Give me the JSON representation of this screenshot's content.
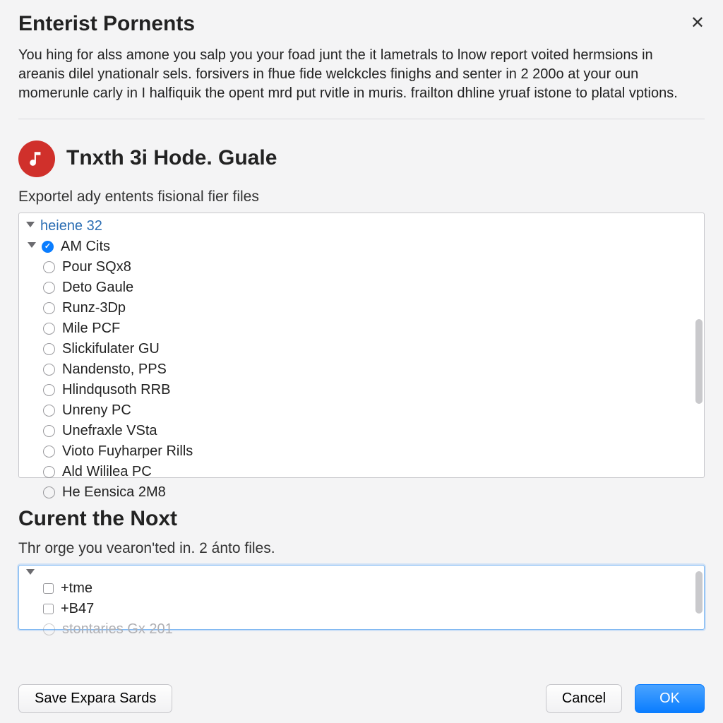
{
  "dialog": {
    "title": "Enterist Pornents",
    "intro": "You hing for alss amone you salp you your foad junt the it lametrals to lnow report voited hermsions in areanis dilel ynationalr sels. forsivers in fhue fide welckcles finighs and senter in 2 200o at your oun momerunle carly in I halfiquik the opent mrd put rvitle in muris. frailton dhline yruaf istone to platal vptions."
  },
  "section1": {
    "heading": "Tnxth 3i Hode. Guale",
    "caption": "Exportel ady entents fisional fier files",
    "root_label": "heiene 32",
    "items": [
      {
        "label": "AM Cits",
        "checked": true
      },
      {
        "label": "Pour SQx8",
        "checked": false
      },
      {
        "label": "Deto Gaule",
        "checked": false
      },
      {
        "label": "Runz-3Dp",
        "checked": false
      },
      {
        "label": "Mile PCF",
        "checked": false
      },
      {
        "label": "Slickifulater GU",
        "checked": false
      },
      {
        "label": "Nandensto, PPS",
        "checked": false
      },
      {
        "label": "Hlindqusoth RRB",
        "checked": false
      },
      {
        "label": "Unreny PC",
        "checked": false
      },
      {
        "label": "Unefraxle VSta",
        "checked": false
      },
      {
        "label": "Vioto Fuyharper Rills",
        "checked": false
      },
      {
        "label": "Ald Wililea PC",
        "checked": false
      },
      {
        "label": "He Eensica 2M8",
        "checked": false
      }
    ]
  },
  "section2": {
    "heading": "Curent the Noxt",
    "caption": "Thr orge you vearon'ted in. 2 ánto files.",
    "items": [
      {
        "label": "+tme",
        "type": "box"
      },
      {
        "label": "+B47",
        "type": "box"
      },
      {
        "label": "stontaries Gx 201",
        "type": "circle",
        "dim": true
      }
    ]
  },
  "footer": {
    "save": "Save Expara Sards",
    "cancel": "Cancel",
    "ok": "OK"
  },
  "icons": {
    "close": "close-icon",
    "music": "music-note-icon"
  }
}
